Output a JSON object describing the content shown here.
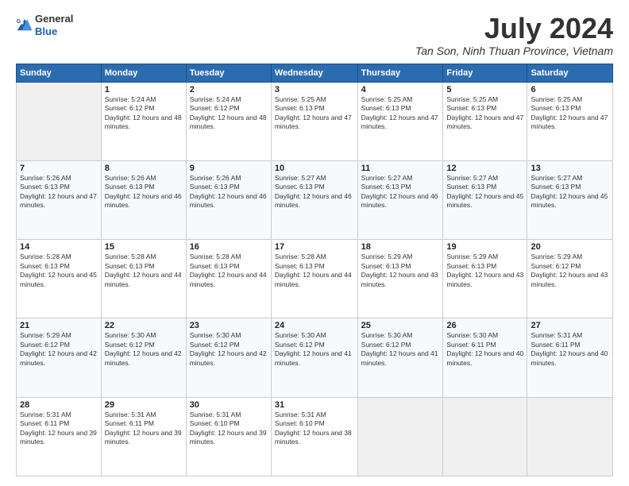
{
  "logo": {
    "text_general": "General",
    "text_blue": "Blue"
  },
  "header": {
    "month_year": "July 2024",
    "location": "Tan Son, Ninh Thuan Province, Vietnam"
  },
  "weekdays": [
    "Sunday",
    "Monday",
    "Tuesday",
    "Wednesday",
    "Thursday",
    "Friday",
    "Saturday"
  ],
  "weeks": [
    [
      {
        "day": "",
        "sunrise": "",
        "sunset": "",
        "daylight": ""
      },
      {
        "day": "1",
        "sunrise": "Sunrise: 5:24 AM",
        "sunset": "Sunset: 6:12 PM",
        "daylight": "Daylight: 12 hours and 48 minutes."
      },
      {
        "day": "2",
        "sunrise": "Sunrise: 5:24 AM",
        "sunset": "Sunset: 6:12 PM",
        "daylight": "Daylight: 12 hours and 48 minutes."
      },
      {
        "day": "3",
        "sunrise": "Sunrise: 5:25 AM",
        "sunset": "Sunset: 6:13 PM",
        "daylight": "Daylight: 12 hours and 47 minutes."
      },
      {
        "day": "4",
        "sunrise": "Sunrise: 5:25 AM",
        "sunset": "Sunset: 6:13 PM",
        "daylight": "Daylight: 12 hours and 47 minutes."
      },
      {
        "day": "5",
        "sunrise": "Sunrise: 5:25 AM",
        "sunset": "Sunset: 6:13 PM",
        "daylight": "Daylight: 12 hours and 47 minutes."
      },
      {
        "day": "6",
        "sunrise": "Sunrise: 5:25 AM",
        "sunset": "Sunset: 6:13 PM",
        "daylight": "Daylight: 12 hours and 47 minutes."
      }
    ],
    [
      {
        "day": "7",
        "sunrise": "Sunrise: 5:26 AM",
        "sunset": "Sunset: 6:13 PM",
        "daylight": "Daylight: 12 hours and 47 minutes."
      },
      {
        "day": "8",
        "sunrise": "Sunrise: 5:26 AM",
        "sunset": "Sunset: 6:13 PM",
        "daylight": "Daylight: 12 hours and 46 minutes."
      },
      {
        "day": "9",
        "sunrise": "Sunrise: 5:26 AM",
        "sunset": "Sunset: 6:13 PM",
        "daylight": "Daylight: 12 hours and 46 minutes."
      },
      {
        "day": "10",
        "sunrise": "Sunrise: 5:27 AM",
        "sunset": "Sunset: 6:13 PM",
        "daylight": "Daylight: 12 hours and 46 minutes."
      },
      {
        "day": "11",
        "sunrise": "Sunrise: 5:27 AM",
        "sunset": "Sunset: 6:13 PM",
        "daylight": "Daylight: 12 hours and 46 minutes."
      },
      {
        "day": "12",
        "sunrise": "Sunrise: 5:27 AM",
        "sunset": "Sunset: 6:13 PM",
        "daylight": "Daylight: 12 hours and 45 minutes."
      },
      {
        "day": "13",
        "sunrise": "Sunrise: 5:27 AM",
        "sunset": "Sunset: 6:13 PM",
        "daylight": "Daylight: 12 hours and 45 minutes."
      }
    ],
    [
      {
        "day": "14",
        "sunrise": "Sunrise: 5:28 AM",
        "sunset": "Sunset: 6:13 PM",
        "daylight": "Daylight: 12 hours and 45 minutes."
      },
      {
        "day": "15",
        "sunrise": "Sunrise: 5:28 AM",
        "sunset": "Sunset: 6:13 PM",
        "daylight": "Daylight: 12 hours and 44 minutes."
      },
      {
        "day": "16",
        "sunrise": "Sunrise: 5:28 AM",
        "sunset": "Sunset: 6:13 PM",
        "daylight": "Daylight: 12 hours and 44 minutes."
      },
      {
        "day": "17",
        "sunrise": "Sunrise: 5:28 AM",
        "sunset": "Sunset: 6:13 PM",
        "daylight": "Daylight: 12 hours and 44 minutes."
      },
      {
        "day": "18",
        "sunrise": "Sunrise: 5:29 AM",
        "sunset": "Sunset: 6:13 PM",
        "daylight": "Daylight: 12 hours and 43 minutes."
      },
      {
        "day": "19",
        "sunrise": "Sunrise: 5:29 AM",
        "sunset": "Sunset: 6:13 PM",
        "daylight": "Daylight: 12 hours and 43 minutes."
      },
      {
        "day": "20",
        "sunrise": "Sunrise: 5:29 AM",
        "sunset": "Sunset: 6:12 PM",
        "daylight": "Daylight: 12 hours and 43 minutes."
      }
    ],
    [
      {
        "day": "21",
        "sunrise": "Sunrise: 5:29 AM",
        "sunset": "Sunset: 6:12 PM",
        "daylight": "Daylight: 12 hours and 42 minutes."
      },
      {
        "day": "22",
        "sunrise": "Sunrise: 5:30 AM",
        "sunset": "Sunset: 6:12 PM",
        "daylight": "Daylight: 12 hours and 42 minutes."
      },
      {
        "day": "23",
        "sunrise": "Sunrise: 5:30 AM",
        "sunset": "Sunset: 6:12 PM",
        "daylight": "Daylight: 12 hours and 42 minutes."
      },
      {
        "day": "24",
        "sunrise": "Sunrise: 5:30 AM",
        "sunset": "Sunset: 6:12 PM",
        "daylight": "Daylight: 12 hours and 41 minutes."
      },
      {
        "day": "25",
        "sunrise": "Sunrise: 5:30 AM",
        "sunset": "Sunset: 6:12 PM",
        "daylight": "Daylight: 12 hours and 41 minutes."
      },
      {
        "day": "26",
        "sunrise": "Sunrise: 5:30 AM",
        "sunset": "Sunset: 6:11 PM",
        "daylight": "Daylight: 12 hours and 40 minutes."
      },
      {
        "day": "27",
        "sunrise": "Sunrise: 5:31 AM",
        "sunset": "Sunset: 6:11 PM",
        "daylight": "Daylight: 12 hours and 40 minutes."
      }
    ],
    [
      {
        "day": "28",
        "sunrise": "Sunrise: 5:31 AM",
        "sunset": "Sunset: 6:11 PM",
        "daylight": "Daylight: 12 hours and 39 minutes."
      },
      {
        "day": "29",
        "sunrise": "Sunrise: 5:31 AM",
        "sunset": "Sunset: 6:11 PM",
        "daylight": "Daylight: 12 hours and 39 minutes."
      },
      {
        "day": "30",
        "sunrise": "Sunrise: 5:31 AM",
        "sunset": "Sunset: 6:10 PM",
        "daylight": "Daylight: 12 hours and 39 minutes."
      },
      {
        "day": "31",
        "sunrise": "Sunrise: 5:31 AM",
        "sunset": "Sunset: 6:10 PM",
        "daylight": "Daylight: 12 hours and 38 minutes."
      },
      {
        "day": "",
        "sunrise": "",
        "sunset": "",
        "daylight": ""
      },
      {
        "day": "",
        "sunrise": "",
        "sunset": "",
        "daylight": ""
      },
      {
        "day": "",
        "sunrise": "",
        "sunset": "",
        "daylight": ""
      }
    ]
  ]
}
